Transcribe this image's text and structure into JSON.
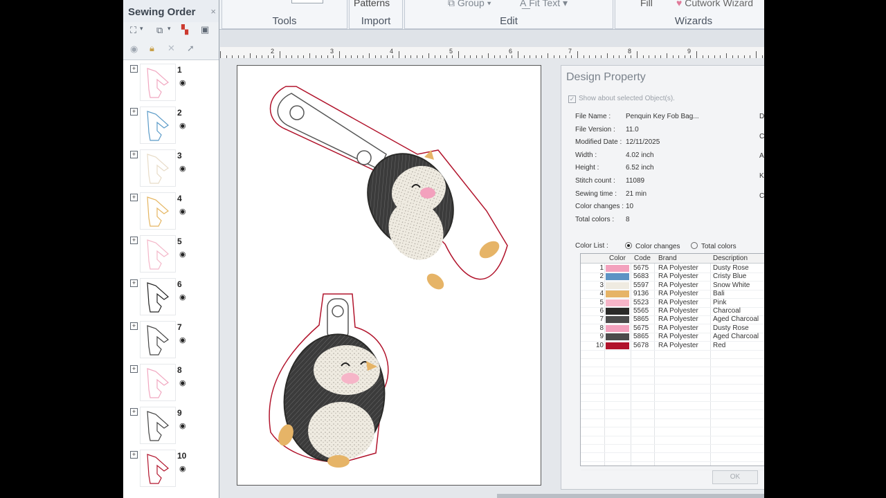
{
  "ribbon": {
    "groups": [
      "Tools",
      "Import",
      "Edit",
      "Wizards"
    ],
    "buttons": {
      "patterns": "Patterns",
      "group": "Group",
      "fit_text": "Fit Text",
      "fill": "Fill",
      "cutwork_wizard": "Cutwork Wizard"
    }
  },
  "sewing_order": {
    "title": "Sewing Order",
    "close": "×",
    "items": [
      {
        "num": "1",
        "color": "#f1a7c0"
      },
      {
        "num": "2",
        "color": "#5b9bc8"
      },
      {
        "num": "3",
        "color": "#e8dcc8"
      },
      {
        "num": "4",
        "color": "#e5b560"
      },
      {
        "num": "5",
        "color": "#f4b7c9"
      },
      {
        "num": "6",
        "color": "#222222"
      },
      {
        "num": "7",
        "color": "#444444"
      },
      {
        "num": "8",
        "color": "#f1a7c0"
      },
      {
        "num": "9",
        "color": "#444444"
      },
      {
        "num": "10",
        "color": "#b2142c"
      }
    ]
  },
  "ruler": {
    "labels": [
      "2",
      "3",
      "4",
      "5",
      "6",
      "7",
      "8",
      "9"
    ]
  },
  "design_property": {
    "title": "Design Property",
    "show_selected": "Show about selected Object(s).",
    "props": [
      {
        "label": "File Name :",
        "value": "Penquin Key Fob Bag..."
      },
      {
        "label": "File Version :",
        "value": "11.0"
      },
      {
        "label": "Modified Date :",
        "value": "12/11/2025"
      },
      {
        "label": "Width :",
        "value": "4.02 inch"
      },
      {
        "label": "Height :",
        "value": "6.52 inch"
      },
      {
        "label": "Stitch count :",
        "value": "11089"
      },
      {
        "label": "Sewing time :",
        "value": "21 min"
      },
      {
        "label": "Color changes :",
        "value": "10"
      },
      {
        "label": "Total colors :",
        "value": "8"
      }
    ],
    "edge_letters": [
      "D",
      "C",
      "A",
      "K",
      "C"
    ],
    "color_list_label": "Color List :",
    "radio_color_changes": "Color changes",
    "radio_total_colors": "Total colors",
    "columns": {
      "color": "Color",
      "code": "Code",
      "brand": "Brand",
      "description": "Description"
    },
    "colors": [
      {
        "n": "1",
        "hex": "#f3a1bd",
        "code": "5675",
        "brand": "RA Polyester",
        "desc": "Dusty Rose"
      },
      {
        "n": "2",
        "hex": "#5c93c4",
        "code": "5683",
        "brand": "RA Polyester",
        "desc": "Cristy Blue"
      },
      {
        "n": "3",
        "hex": "#efebe1",
        "code": "5597",
        "brand": "RA Polyester",
        "desc": "Snow White"
      },
      {
        "n": "4",
        "hex": "#e6b467",
        "code": "9136",
        "brand": "RA Polyester",
        "desc": "Bali"
      },
      {
        "n": "5",
        "hex": "#f6b5c8",
        "code": "5523",
        "brand": "RA Polyester",
        "desc": "Pink"
      },
      {
        "n": "6",
        "hex": "#2a2a28",
        "code": "5565",
        "brand": "RA Polyester",
        "desc": "Charcoal"
      },
      {
        "n": "7",
        "hex": "#4b4b4b",
        "code": "5865",
        "brand": "RA Polyester",
        "desc": "Aged Charcoal"
      },
      {
        "n": "8",
        "hex": "#f3a1bd",
        "code": "5675",
        "brand": "RA Polyester",
        "desc": "Dusty Rose"
      },
      {
        "n": "9",
        "hex": "#4b4b4b",
        "code": "5865",
        "brand": "RA Polyester",
        "desc": "Aged Charcoal"
      },
      {
        "n": "10",
        "hex": "#b1132b",
        "code": "5678",
        "brand": "RA Polyester",
        "desc": "Red"
      }
    ],
    "ok": "OK"
  }
}
